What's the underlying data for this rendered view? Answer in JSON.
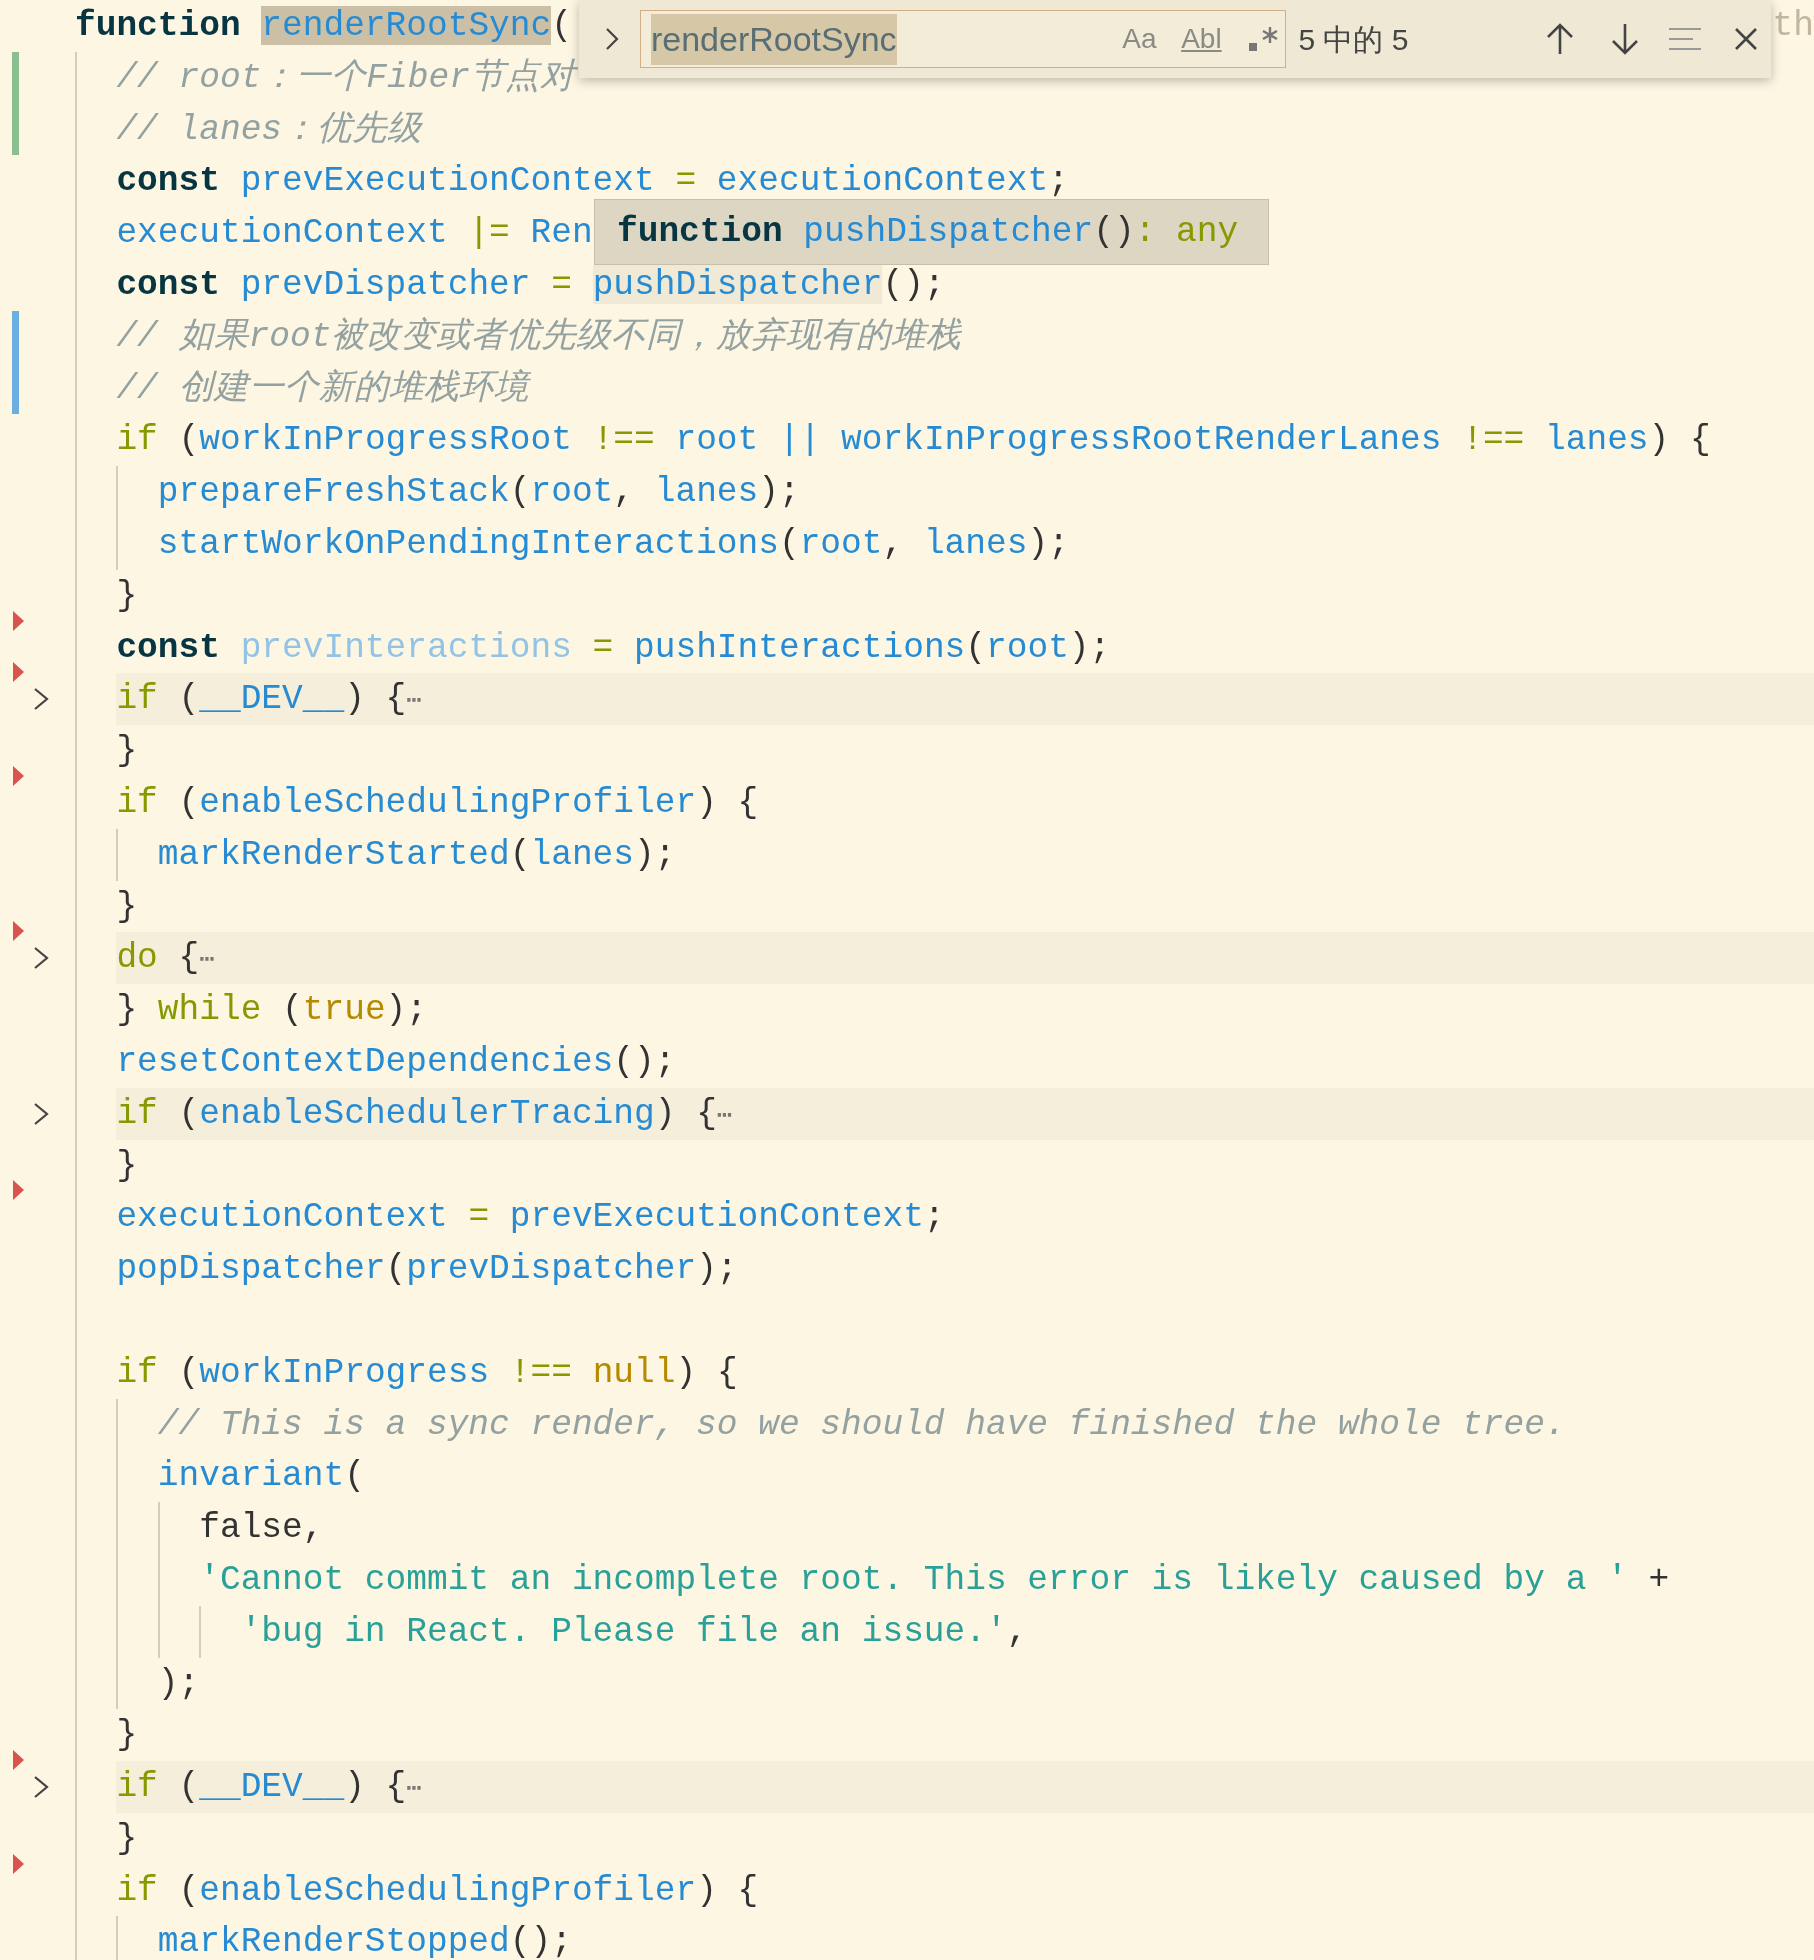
{
  "editor": {
    "lines": [
      {
        "folded": false,
        "deleted_above": false,
        "edge_text": "th",
        "tokens": [
          {
            "kind": "kw",
            "s": "function "
          },
          {
            "kind": "id",
            "s": "renderRootSync",
            "find_match": true
          },
          {
            "kind": "p",
            "s": "("
          }
        ],
        "children": [
          {
            "folded": false,
            "deleted_above": false,
            "added": true,
            "tokens": [
              {
                "kind": "cm",
                "s": "// root：一个Fiber节点对"
              }
            ]
          },
          {
            "folded": false,
            "deleted_above": false,
            "added": true,
            "tokens": [
              {
                "kind": "cm",
                "s": "// lanes：优先级"
              }
            ]
          },
          {
            "folded": false,
            "deleted_above": false,
            "tokens": [
              {
                "kind": "kw",
                "s": "const "
              },
              {
                "kind": "id",
                "s": "prevExecutionContext"
              },
              {
                "kind": "op",
                "s": " = "
              },
              {
                "kind": "id",
                "s": "executionContext"
              },
              {
                "kind": "p",
                "s": ";"
              }
            ]
          },
          {
            "folded": false,
            "deleted_above": false,
            "tokens": [
              {
                "kind": "id",
                "s": "executionContext"
              },
              {
                "kind": "op",
                "s": " |= "
              },
              {
                "kind": "id",
                "s": "Ren"
              }
            ]
          },
          {
            "folded": false,
            "deleted_above": false,
            "tokens": [
              {
                "kind": "kw",
                "s": "const "
              },
              {
                "kind": "id",
                "s": "prevDispatcher"
              },
              {
                "kind": "op",
                "s": " = "
              },
              {
                "kind": "id",
                "s": "pushDispatcher",
                "hovered": true
              },
              {
                "kind": "p",
                "s": "();"
              }
            ]
          },
          {
            "folded": false,
            "deleted_above": false,
            "modified": true,
            "tokens": [
              {
                "kind": "cm",
                "s": "// 如果root被改变或者优先级不同，放弃现有的堆栈"
              }
            ]
          },
          {
            "folded": false,
            "deleted_above": false,
            "modified": true,
            "tokens": [
              {
                "kind": "cm",
                "s": "// 创建一个新的堆栈环境"
              }
            ]
          },
          {
            "folded": false,
            "deleted_above": false,
            "tokens": [
              {
                "kind": "ctl",
                "s": "if "
              },
              {
                "kind": "p",
                "s": "("
              },
              {
                "kind": "id",
                "s": "workInProgressRoot"
              },
              {
                "kind": "op",
                "s": " !== "
              },
              {
                "kind": "id",
                "s": "root || workInProgressRootRenderLanes"
              },
              {
                "kind": "op",
                "s": " !== "
              },
              {
                "kind": "id",
                "s": "lanes"
              },
              {
                "kind": "p",
                "s": ") {"
              }
            ],
            "children": [
              {
                "folded": false,
                "deleted_above": false,
                "tokens": [
                  {
                    "kind": "id",
                    "s": "prepareFreshStack"
                  },
                  {
                    "kind": "p",
                    "s": "("
                  },
                  {
                    "kind": "id",
                    "s": "root"
                  },
                  {
                    "kind": "p",
                    "s": ", "
                  },
                  {
                    "kind": "id",
                    "s": "lanes"
                  },
                  {
                    "kind": "p",
                    "s": ");"
                  }
                ]
              },
              {
                "folded": false,
                "deleted_above": false,
                "tokens": [
                  {
                    "kind": "id",
                    "s": "startWorkOnPendingInteractions"
                  },
                  {
                    "kind": "p",
                    "s": "("
                  },
                  {
                    "kind": "id",
                    "s": "root"
                  },
                  {
                    "kind": "p",
                    "s": ", "
                  },
                  {
                    "kind": "id",
                    "s": "lanes"
                  },
                  {
                    "kind": "p",
                    "s": ");"
                  }
                ]
              }
            ]
          },
          {
            "folded": false,
            "deleted_above": false,
            "tokens": [
              {
                "kind": "p",
                "s": "}"
              }
            ]
          },
          {
            "folded": false,
            "deleted_above": true,
            "tokens": [
              {
                "kind": "kw",
                "s": "const "
              },
              {
                "kind": "unused",
                "s": "prevInteractions"
              },
              {
                "kind": "op",
                "s": " = "
              },
              {
                "kind": "id",
                "s": "pushInteractions"
              },
              {
                "kind": "p",
                "s": "("
              },
              {
                "kind": "id",
                "s": "root"
              },
              {
                "kind": "p",
                "s": ");"
              }
            ]
          },
          {
            "folded": true,
            "deleted_above": true,
            "tokens": [
              {
                "kind": "ctl",
                "s": "if "
              },
              {
                "kind": "p",
                "s": "("
              },
              {
                "kind": "id",
                "s": "__DEV__"
              },
              {
                "kind": "p",
                "s": ") {"
              },
              {
                "kind": "fold",
                "s": "⋯"
              }
            ]
          },
          {
            "folded": false,
            "deleted_above": false,
            "tokens": [
              {
                "kind": "p",
                "s": "}"
              }
            ]
          },
          {
            "folded": false,
            "deleted_above": true,
            "tokens": [
              {
                "kind": "ctl",
                "s": "if "
              },
              {
                "kind": "p",
                "s": "("
              },
              {
                "kind": "id",
                "s": "enableSchedulingProfiler"
              },
              {
                "kind": "p",
                "s": ") {"
              }
            ],
            "children": [
              {
                "folded": false,
                "deleted_above": false,
                "tokens": [
                  {
                    "kind": "id",
                    "s": "markRenderStarted"
                  },
                  {
                    "kind": "p",
                    "s": "("
                  },
                  {
                    "kind": "id",
                    "s": "lanes"
                  },
                  {
                    "kind": "p",
                    "s": ");"
                  }
                ]
              }
            ]
          },
          {
            "folded": false,
            "deleted_above": false,
            "tokens": [
              {
                "kind": "p",
                "s": "}"
              }
            ]
          },
          {
            "folded": true,
            "deleted_above": true,
            "tokens": [
              {
                "kind": "ctl",
                "s": "do "
              },
              {
                "kind": "p",
                "s": "{"
              },
              {
                "kind": "fold",
                "s": "⋯"
              }
            ]
          },
          {
            "folded": false,
            "deleted_above": false,
            "tokens": [
              {
                "kind": "p",
                "s": "} "
              },
              {
                "kind": "ctl",
                "s": "while "
              },
              {
                "kind": "p",
                "s": "("
              },
              {
                "kind": "lit",
                "s": "true"
              },
              {
                "kind": "p",
                "s": ");"
              }
            ]
          },
          {
            "folded": false,
            "deleted_above": false,
            "tokens": [
              {
                "kind": "id",
                "s": "resetContextDependencies"
              },
              {
                "kind": "p",
                "s": "();"
              }
            ]
          },
          {
            "folded": true,
            "deleted_above": false,
            "tokens": [
              {
                "kind": "ctl",
                "s": "if "
              },
              {
                "kind": "p",
                "s": "("
              },
              {
                "kind": "id",
                "s": "enableSchedulerTracing"
              },
              {
                "kind": "p",
                "s": ") {"
              },
              {
                "kind": "fold",
                "s": "⋯"
              }
            ]
          },
          {
            "folded": false,
            "deleted_above": false,
            "tokens": [
              {
                "kind": "p",
                "s": "}"
              }
            ]
          },
          {
            "folded": false,
            "deleted_above": true,
            "tokens": [
              {
                "kind": "id",
                "s": "executionContext"
              },
              {
                "kind": "op",
                "s": " = "
              },
              {
                "kind": "id",
                "s": "prevExecutionContext"
              },
              {
                "kind": "p",
                "s": ";"
              }
            ]
          },
          {
            "folded": false,
            "deleted_above": false,
            "tokens": [
              {
                "kind": "id",
                "s": "popDispatcher"
              },
              {
                "kind": "p",
                "s": "("
              },
              {
                "kind": "id",
                "s": "prevDispatcher"
              },
              {
                "kind": "p",
                "s": ");"
              }
            ]
          },
          {
            "folded": false,
            "deleted_above": false
          },
          {
            "folded": false,
            "deleted_above": false,
            "tokens": [
              {
                "kind": "ctl",
                "s": "if "
              },
              {
                "kind": "p",
                "s": "("
              },
              {
                "kind": "id",
                "s": "workInProgress"
              },
              {
                "kind": "op",
                "s": " !== "
              },
              {
                "kind": "lit",
                "s": "null"
              },
              {
                "kind": "p",
                "s": ") {"
              }
            ],
            "children": [
              {
                "folded": false,
                "deleted_above": false,
                "tokens": [
                  {
                    "kind": "cm",
                    "s": "// This is a sync render, so we should have finished the whole tree."
                  }
                ]
              },
              {
                "folded": false,
                "deleted_above": false,
                "tokens": [
                  {
                    "kind": "id",
                    "s": "invariant"
                  },
                  {
                    "kind": "p",
                    "s": "("
                  }
                ],
                "children": [
                  {
                    "folded": false,
                    "deleted_above": false,
                    "tokens": [
                      {
                        "kind": "p",
                        "s": "false,"
                      }
                    ]
                  },
                  {
                    "folded": false,
                    "deleted_above": false,
                    "tokens": [
                      {
                        "kind": "str",
                        "s": "'Cannot commit an incomplete root. This error is likely caused by a '"
                      },
                      {
                        "kind": "p",
                        "s": " +"
                      }
                    ],
                    "children": [
                      {
                        "folded": false,
                        "deleted_above": false,
                        "tokens": [
                          {
                            "kind": "str",
                            "s": "'bug in React. Please file an issue.'"
                          },
                          {
                            "kind": "p",
                            "s": ","
                          }
                        ]
                      }
                    ]
                  }
                ]
              },
              {
                "folded": false,
                "deleted_above": false,
                "tokens": [
                  {
                    "kind": "p",
                    "s": ");"
                  }
                ]
              }
            ]
          },
          {
            "folded": false,
            "deleted_above": false,
            "tokens": [
              {
                "kind": "p",
                "s": "}"
              }
            ]
          },
          {
            "folded": true,
            "deleted_above": true,
            "tokens": [
              {
                "kind": "ctl",
                "s": "if "
              },
              {
                "kind": "p",
                "s": "("
              },
              {
                "kind": "id",
                "s": "__DEV__"
              },
              {
                "kind": "p",
                "s": ") {"
              },
              {
                "kind": "fold",
                "s": "⋯"
              }
            ]
          },
          {
            "folded": false,
            "deleted_above": false,
            "tokens": [
              {
                "kind": "p",
                "s": "}"
              }
            ]
          },
          {
            "folded": false,
            "deleted_above": true,
            "tokens": [
              {
                "kind": "ctl",
                "s": "if "
              },
              {
                "kind": "p",
                "s": "("
              },
              {
                "kind": "id",
                "s": "enableSchedulingProfiler"
              },
              {
                "kind": "p",
                "s": ") {"
              }
            ],
            "children": [
              {
                "folded": false,
                "deleted_above": false,
                "tokens": [
                  {
                    "kind": "id",
                    "s": "markRenderStopped"
                  },
                  {
                    "kind": "p",
                    "s": "();"
                  }
                ]
              }
            ]
          }
        ]
      }
    ]
  },
  "find_widget": {
    "query": "renderRootSync",
    "query_selected": true,
    "options": [
      {
        "kind": "case",
        "label": "Aa",
        "on": false
      },
      {
        "kind": "word",
        "label": "Abl",
        "on": false
      },
      {
        "kind": "regex",
        "on": false
      }
    ],
    "match_count": "5 中的 5"
  },
  "hover": {
    "tokens": [
      {
        "kind": "kw",
        "s": "function "
      },
      {
        "kind": "id",
        "s": "pushDispatcher"
      },
      {
        "kind": "p",
        "s": "()"
      },
      {
        "kind": "op",
        "s": ": "
      },
      {
        "kind": "type",
        "s": "any"
      }
    ]
  }
}
